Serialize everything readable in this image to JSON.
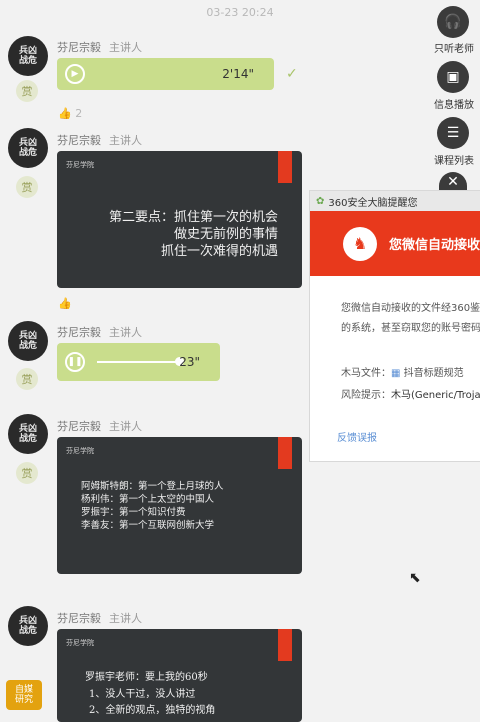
{
  "timestamp": "03-23 20:24",
  "side_panel": {
    "listen": {
      "label": "只听老师",
      "icon": "headphones-icon"
    },
    "replay": {
      "label": "信息播放",
      "icon": "play-square-icon"
    },
    "course": {
      "label": "课程列表",
      "icon": "list-icon"
    },
    "close": {
      "icon": "close-icon"
    }
  },
  "messages": [
    {
      "sender": "芬尼宗毅",
      "role": "主讲人",
      "avatar_text": "兵\n凶\n战\n危",
      "badge": "赏",
      "voice": {
        "duration": "2'14\"",
        "like_count": "2"
      }
    },
    {
      "sender": "芬尼宗毅",
      "role": "主讲人",
      "avatar_text": "兵\n凶\n战\n危",
      "badge": "赏",
      "slide": {
        "logo": "芬尼学院",
        "lines": [
          "第二要点：抓住第一次的机会",
          "做史无前例的事情",
          "抓住一次难得的机遇"
        ]
      }
    },
    {
      "sender": "芬尼宗毅",
      "role": "主讲人",
      "avatar_text": "兵\n凶\n战\n危",
      "badge": "赏",
      "voice": {
        "duration": "23\""
      }
    },
    {
      "sender": "芬尼宗毅",
      "role": "主讲人",
      "avatar_text": "兵\n凶\n战\n危",
      "badge": "赏",
      "slide": {
        "logo": "芬尼学院",
        "lines": [
          "阿姆斯特朗：第一个登上月球的人",
          "杨利伟：第一个上太空的中国人",
          "罗振宇：第一个知识付费",
          "李善友：第一个互联网创新大学"
        ]
      }
    },
    {
      "sender": "芬尼宗毅",
      "role": "主讲人",
      "avatar_text": "兵\n凶\n战\n危",
      "badge": "自媒\n研究",
      "slide": {
        "logo": "芬尼学院",
        "lines": [
          "罗振宇老师：要上我的60秒",
          "1、没人干过，没人讲过",
          "2、全新的观点，独特的视角"
        ]
      }
    }
  ],
  "popup": {
    "title": "360安全大脑提醒您",
    "banner": "您微信自动接收",
    "body": [
      "您微信自动接收的文件经360鉴",
      "的系统，甚至窃取您的账号密码"
    ],
    "file_label": "木马文件：",
    "file_name": "抖音标题规范",
    "risk_label": "风险提示：",
    "risk_value": "木马(Generic/Troja",
    "link": "反馈误报"
  },
  "colors": {
    "voice_bg": "#c9dd8c",
    "slide_bg": "#333638",
    "accent_red": "#e33a1f",
    "popup_red": "#e8391c"
  }
}
